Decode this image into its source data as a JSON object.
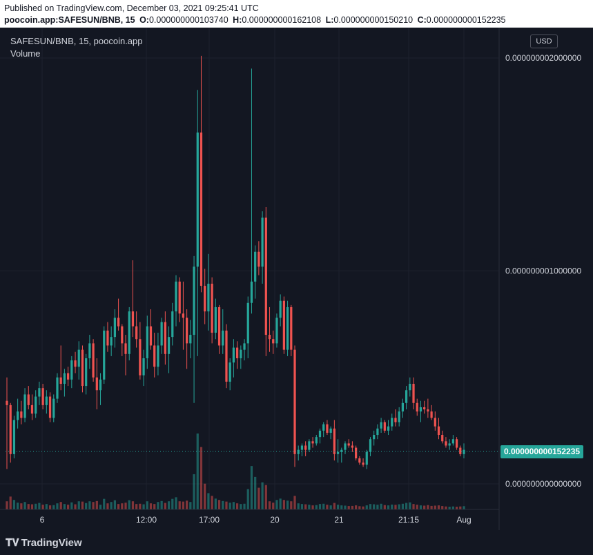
{
  "header": {
    "published": "Published on TradingView.com, December 03, 2021 09:25:41 UTC",
    "symbol": "poocoin.app:SAFESUN/BNB, 15",
    "open_key": "O:",
    "open": "0.000000000103740",
    "high_key": "H:",
    "high": "0.000000000162108",
    "low_key": "L:",
    "low": "0.000000000150210",
    "close_key": "C:",
    "close": "0.000000000152235"
  },
  "chart_title": "SAFESUN/BNB, 15, poocoin.app",
  "volume_label": "Volume",
  "currency": "USD",
  "last_price": "0.000000000152235",
  "brand": "TradingView",
  "colors": {
    "up": "#26a69a",
    "down": "#ef5350",
    "background": "#131722",
    "grid": "#1e222d"
  },
  "chart_data": {
    "type": "candlestick",
    "ylim": [
      -1e-10,
      2.1e-09
    ],
    "y_ticks": [
      {
        "value": 2e-09,
        "label": "0.000000002000000"
      },
      {
        "value": 1e-09,
        "label": "0.000000001000000"
      },
      {
        "value": 0.0,
        "label": "0.000000000000000"
      }
    ],
    "x_ticks": [
      "6",
      "12:00",
      "17:00",
      "20",
      "21",
      "21:15",
      "Aug"
    ],
    "last_close": 1.52235e-10,
    "candles": [
      [
        3.9e-10,
        5e-10,
        7e-11,
        3.7e-10,
        60
      ],
      [
        3.7e-10,
        3.8e-10,
        1e-10,
        1.4e-10,
        95
      ],
      [
        1.4e-10,
        3.2e-10,
        1.2e-10,
        3e-10,
        70
      ],
      [
        3e-10,
        4e-10,
        2.6e-10,
        3.4e-10,
        50
      ],
      [
        3.4e-10,
        3.9e-10,
        2.8e-10,
        3.1e-10,
        45
      ],
      [
        3.1e-10,
        4.5e-10,
        2.9e-10,
        4.2e-10,
        55
      ],
      [
        4.2e-10,
        4.6e-10,
        3.5e-10,
        3.7e-10,
        40
      ],
      [
        3.7e-10,
        4.2e-10,
        3e-10,
        3.3e-10,
        38
      ],
      [
        3.3e-10,
        4.4e-10,
        3.1e-10,
        4.1e-10,
        42
      ],
      [
        4.1e-10,
        4.8e-10,
        3.7e-10,
        4.5e-10,
        48
      ],
      [
        4.5e-10,
        4.7e-10,
        3.5e-10,
        3.7e-10,
        35
      ],
      [
        3.7e-10,
        4.4e-10,
        3.3e-10,
        4.1e-10,
        40
      ],
      [
        4.1e-10,
        4.3e-10,
        2.9e-10,
        3.1e-10,
        30
      ],
      [
        3.1e-10,
        4.2e-10,
        2.9e-10,
        4e-10,
        32
      ],
      [
        4e-10,
        5.2e-10,
        3.8e-10,
        5e-10,
        45
      ],
      [
        5e-10,
        6.5e-10,
        4.4e-10,
        4.7e-10,
        55
      ],
      [
        4.7e-10,
        5.4e-10,
        4.1e-10,
        5.2e-10,
        40
      ],
      [
        5.2e-10,
        5.5e-10,
        4.6e-10,
        4.9e-10,
        35
      ],
      [
        4.9e-10,
        6e-10,
        4.5e-10,
        5.8e-10,
        52
      ],
      [
        5.8e-10,
        6.2e-10,
        5.2e-10,
        5.5e-10,
        38
      ],
      [
        5.5e-10,
        6.7e-10,
        4.9e-10,
        6.3e-10,
        60
      ],
      [
        6.3e-10,
        6.5e-10,
        4.3e-10,
        4.6e-10,
        58
      ],
      [
        4.6e-10,
        6.1e-10,
        4.2e-10,
        5.9e-10,
        47
      ],
      [
        5.9e-10,
        7e-10,
        5.4e-10,
        6.6e-10,
        60
      ],
      [
        6.6e-10,
        6.8e-10,
        4.8e-10,
        5e-10,
        55
      ],
      [
        5e-10,
        5.9e-10,
        3.5e-10,
        4.4e-10,
        62
      ],
      [
        4.4e-10,
        5.2e-10,
        3.7e-10,
        4.9e-10,
        35
      ],
      [
        4.9e-10,
        7.4e-10,
        4.7e-10,
        7.2e-10,
        78
      ],
      [
        7.2e-10,
        7.6e-10,
        6.2e-10,
        6.5e-10,
        45
      ],
      [
        6.5e-10,
        7.4e-10,
        6e-10,
        6.9e-10,
        55
      ],
      [
        6.9e-10,
        8.2e-10,
        6.4e-10,
        7.8e-10,
        68
      ],
      [
        7.8e-10,
        8.7e-10,
        7.2e-10,
        7.4e-10,
        40
      ],
      [
        7.4e-10,
        7.5e-10,
        6e-10,
        6.6e-10,
        45
      ],
      [
        6.6e-10,
        7e-10,
        5.1e-10,
        6.1e-10,
        50
      ],
      [
        6.1e-10,
        8.3e-10,
        5.8e-10,
        8.1e-10,
        68
      ],
      [
        8.1e-10,
        1.05e-09,
        6.9e-10,
        7.4e-10,
        60
      ],
      [
        7.4e-10,
        8.1e-10,
        6.4e-10,
        6.8e-10,
        40
      ],
      [
        6.8e-10,
        7.6e-10,
        4.9e-10,
        5.1e-10,
        42
      ],
      [
        5.1e-10,
        6.3e-10,
        4.6e-10,
        5.9e-10,
        38
      ],
      [
        5.9e-10,
        7.9e-10,
        5.4e-10,
        7.4e-10,
        60
      ],
      [
        7.4e-10,
        8.2e-10,
        6.3e-10,
        6.5e-10,
        45
      ],
      [
        6.5e-10,
        7.1e-10,
        5e-10,
        5.5e-10,
        40
      ],
      [
        5.5e-10,
        7.1e-10,
        5.1e-10,
        6.5e-10,
        55
      ],
      [
        6.5e-10,
        7.8e-10,
        6.1e-10,
        7.6e-10,
        62
      ],
      [
        7.6e-10,
        8.1e-10,
        5.6e-10,
        6.1e-10,
        48
      ],
      [
        6.1e-10,
        7.4e-10,
        5.2e-10,
        6.9e-10,
        60
      ],
      [
        6.9e-10,
        8.5e-10,
        6.5e-10,
        8.1e-10,
        78
      ],
      [
        8.1e-10,
        9.8e-10,
        7.4e-10,
        9.5e-10,
        90
      ],
      [
        9.5e-10,
        9.7e-10,
        7.6e-10,
        8e-10,
        60
      ],
      [
        8e-10,
        9.5e-10,
        6.3e-10,
        7.8e-10,
        58
      ],
      [
        7.8e-10,
        8.2e-10,
        5.4e-10,
        6.6e-10,
        65
      ],
      [
        6.6e-10,
        7.7e-10,
        5.9e-10,
        7e-10,
        55
      ],
      [
        7e-10,
        1.07e-09,
        3.8e-10,
        1.02e-09,
        260
      ],
      [
        1.02e-09,
        1.85e-09,
        6e-10,
        1.65e-09,
        560
      ],
      [
        1.65e-09,
        2.01e-09,
        9e-10,
        9.3e-10,
        460
      ],
      [
        9.3e-10,
        1.01e-09,
        7.5e-10,
        8.1e-10,
        190
      ],
      [
        8.1e-10,
        1.08e-09,
        7.2e-10,
        9.4e-10,
        120
      ],
      [
        9.4e-10,
        9.7e-10,
        6.6e-10,
        7.1e-10,
        100
      ],
      [
        7.1e-10,
        8.7e-10,
        6.8e-10,
        8.3e-10,
        80
      ],
      [
        8.3e-10,
        8.4e-10,
        6.1e-10,
        6.5e-10,
        70
      ],
      [
        6.5e-10,
        8.2e-10,
        6.1e-10,
        7.2e-10,
        62
      ],
      [
        7.2e-10,
        7.5e-10,
        4.5e-10,
        4.8e-10,
        58
      ],
      [
        4.8e-10,
        5.9e-10,
        4.4e-10,
        5.7e-10,
        50
      ],
      [
        5.7e-10,
        6.8e-10,
        5e-10,
        6.4e-10,
        55
      ],
      [
        6.4e-10,
        6.7e-10,
        5.4e-10,
        5.9e-10,
        45
      ],
      [
        5.9e-10,
        6.5e-10,
        5.4e-10,
        6.3e-10,
        40
      ],
      [
        6.3e-10,
        6.8e-10,
        5.8e-10,
        6.6e-10,
        42
      ],
      [
        6.6e-10,
        8.8e-10,
        5.9e-10,
        8.5e-10,
        150
      ],
      [
        8.5e-10,
        1.95e-09,
        8e-10,
        9.5e-10,
        320
      ],
      [
        9.5e-10,
        1.12e-09,
        8.7e-10,
        1.09e-09,
        240
      ],
      [
        1.09e-09,
        1.14e-09,
        9.8e-10,
        1.02e-09,
        160
      ],
      [
        1.02e-09,
        1.28e-09,
        9.4e-10,
        1.25e-09,
        200
      ],
      [
        1.25e-09,
        1.3e-09,
        6e-10,
        7e-10,
        180
      ],
      [
        7e-10,
        8.3e-10,
        6.2e-10,
        6.8e-10,
        60
      ],
      [
        6.8e-10,
        7.2e-10,
        6.1e-10,
        6.6e-10,
        50
      ],
      [
        6.6e-10,
        8e-10,
        6.4e-10,
        7.8e-10,
        70
      ],
      [
        7.8e-10,
        8.9e-10,
        7.4e-10,
        8.6e-10,
        80
      ],
      [
        8.6e-10,
        8.8e-10,
        6.1e-10,
        6.3e-10,
        70
      ],
      [
        6.3e-10,
        8.6e-10,
        6e-10,
        8.3e-10,
        65
      ],
      [
        8.3e-10,
        8.4e-10,
        6e-10,
        6.3e-10,
        60
      ],
      [
        6.3e-10,
        6.5e-10,
        8e-11,
        1.4e-10,
        100
      ],
      [
        1.4e-10,
        1.8e-10,
        1.1e-10,
        1.6e-10,
        45
      ],
      [
        1.6e-10,
        1.9e-10,
        1.3e-10,
        1.8e-10,
        40
      ],
      [
        1.8e-10,
        2e-10,
        1.3e-10,
        1.6e-10,
        38
      ],
      [
        1.6e-10,
        2.1e-10,
        1.5e-10,
        2e-10,
        35
      ],
      [
        2e-10,
        2.2e-10,
        1.7e-10,
        1.9e-10,
        30
      ],
      [
        1.9e-10,
        2.3e-10,
        1.8e-10,
        2.2e-10,
        32
      ],
      [
        2.2e-10,
        2.6e-10,
        1.9e-10,
        2.5e-10,
        40
      ],
      [
        2.5e-10,
        2.9e-10,
        2.2e-10,
        2.8e-10,
        42
      ],
      [
        2.8e-10,
        3e-10,
        2.3e-10,
        2.4e-10,
        35
      ],
      [
        2.4e-10,
        2.7e-10,
        2.1e-10,
        2.6e-10,
        30
      ],
      [
        2.6e-10,
        3e-10,
        1.1e-10,
        1.4e-10,
        48
      ],
      [
        1.4e-10,
        2.1e-10,
        1e-10,
        1.5e-10,
        35
      ],
      [
        1.5e-10,
        1.7e-10,
        1e-10,
        1.6e-10,
        30
      ],
      [
        1.6e-10,
        2e-10,
        1.4e-10,
        1.9e-10,
        28
      ],
      [
        1.9e-10,
        2.1e-10,
        1.7e-10,
        1.8e-10,
        25
      ],
      [
        1.8e-10,
        2e-10,
        1.5e-10,
        1.7e-10,
        26
      ],
      [
        1.7e-10,
        1.8e-10,
        1.1e-10,
        1.2e-10,
        30
      ],
      [
        1.2e-10,
        1.3e-10,
        9e-11,
        1e-10,
        24
      ],
      [
        1e-10,
        1.2e-10,
        8e-11,
        9e-11,
        22
      ],
      [
        9e-11,
        1.6e-10,
        7e-11,
        1.5e-10,
        30
      ],
      [
        1.5e-10,
        2.2e-10,
        1.3e-10,
        2.1e-10,
        40
      ],
      [
        2.1e-10,
        2.5e-10,
        1.8e-10,
        2.3e-10,
        38
      ],
      [
        2.3e-10,
        2.8e-10,
        2.1e-10,
        2.6e-10,
        35
      ],
      [
        2.6e-10,
        3.1e-10,
        2.4e-10,
        2.9e-10,
        42
      ],
      [
        2.9e-10,
        3e-10,
        2.4e-10,
        2.5e-10,
        32
      ],
      [
        2.5e-10,
        3e-10,
        2.3e-10,
        2.7e-10,
        30
      ],
      [
        2.7e-10,
        3.3e-10,
        2.5e-10,
        3.1e-10,
        36
      ],
      [
        3.1e-10,
        3.5e-10,
        2.7e-10,
        2.9e-10,
        34
      ],
      [
        2.9e-10,
        3.6e-10,
        2.7e-10,
        3.4e-10,
        38
      ],
      [
        3.4e-10,
        4e-10,
        3.1e-10,
        3.8e-10,
        42
      ],
      [
        3.8e-10,
        4.6e-10,
        3.5e-10,
        4.4e-10,
        48
      ],
      [
        4.4e-10,
        5e-10,
        4.1e-10,
        4.7e-10,
        52
      ],
      [
        4.7e-10,
        5e-10,
        3.5e-10,
        3.8e-10,
        40
      ],
      [
        3.8e-10,
        4e-10,
        3.2e-10,
        3.4e-10,
        35
      ],
      [
        3.4e-10,
        3.9e-10,
        2.9e-10,
        3.6e-10,
        30
      ],
      [
        3.6e-10,
        3.9e-10,
        3.3e-10,
        3.5e-10,
        28
      ],
      [
        3.5e-10,
        4e-10,
        3.1e-10,
        3.4e-10,
        32
      ],
      [
        3.4e-10,
        3.7e-10,
        3e-10,
        3.1e-10,
        26
      ],
      [
        3.1e-10,
        3.4e-10,
        2.5e-10,
        2.7e-10,
        28
      ],
      [
        2.7e-10,
        3.1e-10,
        2.1e-10,
        2.3e-10,
        30
      ],
      [
        2.3e-10,
        2.5e-10,
        1.9e-10,
        2e-10,
        25
      ],
      [
        2e-10,
        2.2e-10,
        1.7e-10,
        1.8e-10,
        22
      ],
      [
        1.8e-10,
        2.1e-10,
        1.6e-10,
        1.9e-10,
        20
      ],
      [
        1.9e-10,
        2.3e-10,
        1.8e-10,
        2.1e-10,
        22
      ],
      [
        2.1e-10,
        2.2e-10,
        1.6e-10,
        1.7e-10,
        20
      ],
      [
        1.7e-10,
        1.8e-10,
        1.3e-10,
        1.4e-10,
        22
      ],
      [
        1.4e-10,
        1.9e-10,
        1.2e-10,
        1.6e-10,
        24
      ]
    ]
  }
}
